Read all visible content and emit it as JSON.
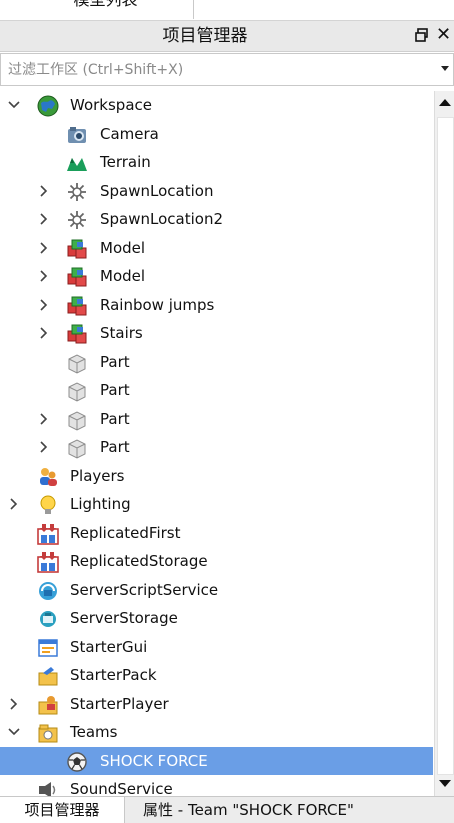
{
  "top_tab": {
    "label": "模型列表"
  },
  "panel": {
    "title": "项目管理器"
  },
  "filter": {
    "placeholder": "过滤工作区 (Ctrl+Shift+X)",
    "value": ""
  },
  "tree": [
    {
      "label": "Workspace",
      "icon": "workspace-globe-icon",
      "expander": "expanded",
      "depth": 0
    },
    {
      "label": "Camera",
      "icon": "camera-icon",
      "expander": "none",
      "depth": 1
    },
    {
      "label": "Terrain",
      "icon": "terrain-icon",
      "expander": "none",
      "depth": 1
    },
    {
      "label": "SpawnLocation",
      "icon": "spawn-location-icon",
      "expander": "collapsed",
      "depth": 1
    },
    {
      "label": "SpawnLocation2",
      "icon": "spawn-location-icon",
      "expander": "collapsed",
      "depth": 1
    },
    {
      "label": "Model",
      "icon": "model-icon",
      "expander": "collapsed",
      "depth": 1
    },
    {
      "label": "Model",
      "icon": "model-icon",
      "expander": "collapsed",
      "depth": 1
    },
    {
      "label": "Rainbow jumps",
      "icon": "model-icon",
      "expander": "collapsed",
      "depth": 1
    },
    {
      "label": "Stairs",
      "icon": "model-icon",
      "expander": "collapsed",
      "depth": 1
    },
    {
      "label": "Part",
      "icon": "part-icon",
      "expander": "none",
      "depth": 1
    },
    {
      "label": "Part",
      "icon": "part-icon",
      "expander": "none",
      "depth": 1
    },
    {
      "label": "Part",
      "icon": "part-icon",
      "expander": "collapsed",
      "depth": 1
    },
    {
      "label": "Part",
      "icon": "part-icon",
      "expander": "collapsed",
      "depth": 1
    },
    {
      "label": "Players",
      "icon": "players-icon",
      "expander": "none",
      "depth": 0
    },
    {
      "label": "Lighting",
      "icon": "lighting-bulb-icon",
      "expander": "collapsed",
      "depth": 0
    },
    {
      "label": "ReplicatedFirst",
      "icon": "replicated-icon",
      "expander": "none",
      "depth": 0
    },
    {
      "label": "ReplicatedStorage",
      "icon": "replicated-icon",
      "expander": "none",
      "depth": 0
    },
    {
      "label": "ServerScriptService",
      "icon": "server-script-service-icon",
      "expander": "none",
      "depth": 0
    },
    {
      "label": "ServerStorage",
      "icon": "server-storage-icon",
      "expander": "none",
      "depth": 0
    },
    {
      "label": "StarterGui",
      "icon": "starter-gui-icon",
      "expander": "none",
      "depth": 0
    },
    {
      "label": "StarterPack",
      "icon": "starter-pack-icon",
      "expander": "none",
      "depth": 0
    },
    {
      "label": "StarterPlayer",
      "icon": "starter-player-icon",
      "expander": "collapsed",
      "depth": 0
    },
    {
      "label": "Teams",
      "icon": "teams-icon",
      "expander": "expanded",
      "depth": 0
    },
    {
      "label": "SHOCK FORCE",
      "icon": "team-icon",
      "expander": "none",
      "depth": 1,
      "selected": true
    },
    {
      "label": "SoundService",
      "icon": "sound-service-icon",
      "expander": "none",
      "depth": 0
    }
  ],
  "bottom_tabs": [
    {
      "label": "项目管理器",
      "active": true
    },
    {
      "label": "属性 - Team \"SHOCK FORCE\"",
      "active": false
    }
  ],
  "colors": {
    "selection": "#6a9ee6",
    "title_bg": "#e9e9e9"
  }
}
